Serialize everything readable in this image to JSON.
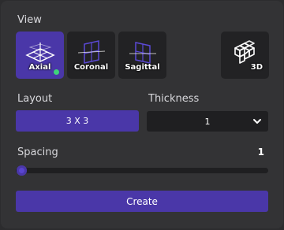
{
  "view": {
    "label": "View",
    "buttons": [
      {
        "label": "Axial",
        "icon": "axial-plane-icon",
        "active": true
      },
      {
        "label": "Coronal",
        "icon": "coronal-plane-icon",
        "active": false
      },
      {
        "label": "Sagittal",
        "icon": "sagittal-plane-icon",
        "active": false
      },
      {
        "label": "3D",
        "icon": "cube-3d-icon",
        "active": false
      }
    ]
  },
  "layout": {
    "label": "Layout",
    "value": "3 X 3"
  },
  "thickness": {
    "label": "Thickness",
    "value": "1"
  },
  "spacing": {
    "label": "Spacing",
    "value": "1",
    "level_fraction": 0.0
  },
  "actions": {
    "create_label": "Create"
  },
  "colors": {
    "accent": "#4a37a8",
    "panel": "#333335",
    "control_bg": "#1f1f21",
    "status_dot": "#3ed47a"
  }
}
